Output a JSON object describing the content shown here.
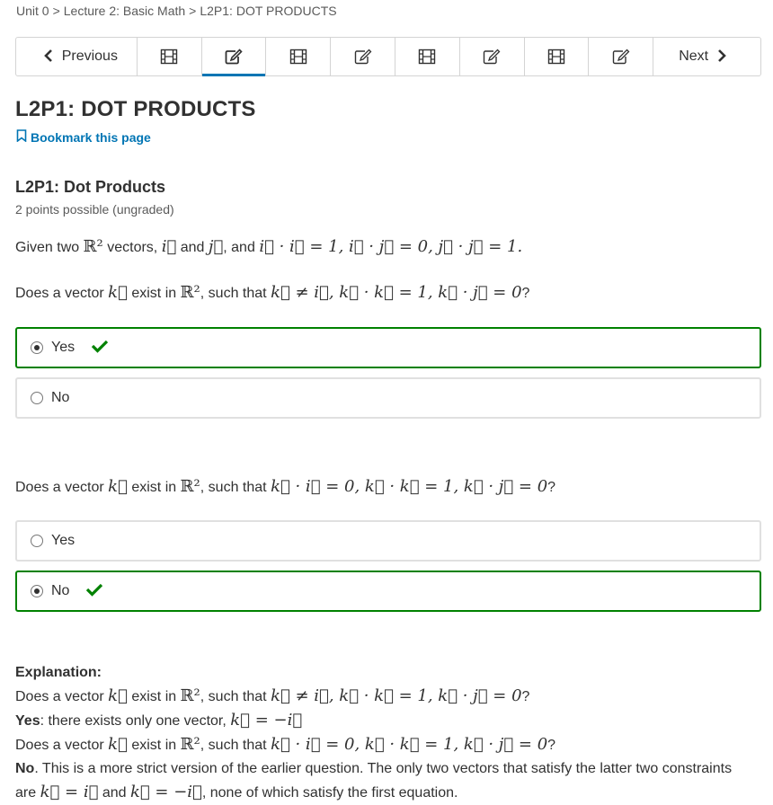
{
  "breadcrumb": {
    "items": [
      "Unit 0",
      "Lecture 2: Basic Math",
      "L2P1: DOT PRODUCTS"
    ],
    "separator": ">"
  },
  "seq_nav": {
    "previous_label": "Previous",
    "next_label": "Next",
    "items": [
      {
        "icon": "video-icon",
        "active": false
      },
      {
        "icon": "problem-edit-icon",
        "active": true
      },
      {
        "icon": "video-icon",
        "active": false
      },
      {
        "icon": "problem-edit-icon",
        "active": false
      },
      {
        "icon": "video-icon",
        "active": false
      },
      {
        "icon": "problem-edit-icon",
        "active": false
      },
      {
        "icon": "video-icon",
        "active": false
      },
      {
        "icon": "problem-edit-icon",
        "active": false
      }
    ],
    "active_color": "#0075b4"
  },
  "unit_title": "L2P1: DOT PRODUCTS",
  "bookmark_label": "Bookmark this page",
  "problem": {
    "title": "L2P1: Dot Products",
    "points": "2 points possible (ungraded)",
    "intro": {
      "prefix": "Given two",
      "r2": "ℝ²",
      "vectors_word": "vectors,",
      "i": "i⃗",
      "and": "and",
      "j": "j⃗",
      "and2": ", and",
      "eq": "i⃗ · i⃗ = 1, i⃗ · j⃗ = 0, j⃗ · j⃗ = 1."
    },
    "q1": {
      "prefix": "Does a vector",
      "k": "k⃗",
      "exist": "exist in",
      "r2": "ℝ²",
      "such": ", such that",
      "cond": "k⃗ ≠ i⃗, k⃗ · k⃗ = 1, k⃗ · j⃗ = 0",
      "q": "?"
    },
    "q1_choices": [
      {
        "label": "Yes",
        "selected": true,
        "correct": true
      },
      {
        "label": "No",
        "selected": false,
        "correct": false
      }
    ],
    "q2": {
      "prefix": "Does a vector",
      "k": "k⃗",
      "exist": "exist in",
      "r2": "ℝ²",
      "such": ", such that",
      "cond": "k⃗ · i⃗ = 0, k⃗ · k⃗ = 1, k⃗ · j⃗ = 0",
      "q": "?"
    },
    "q2_choices": [
      {
        "label": "Yes",
        "selected": false,
        "correct": false
      },
      {
        "label": "No",
        "selected": true,
        "correct": true
      }
    ],
    "correct_color": "#008100"
  },
  "explanation": {
    "heading": "Explanation:",
    "line1": {
      "prefix": "Does a vector",
      "k": "k⃗",
      "exist": "exist in",
      "r2": "ℝ²",
      "such": ", such that",
      "cond": "k⃗ ≠ i⃗, k⃗ · k⃗ = 1, k⃗ · j⃗ = 0",
      "q": "?"
    },
    "line2": {
      "bold": "Yes",
      "text": ": there exists only one vector,",
      "math": "k⃗ = −i⃗"
    },
    "line3": {
      "prefix": "Does a vector",
      "k": "k⃗",
      "exist": "exist in",
      "r2": "ℝ²",
      "such": ", such that",
      "cond": "k⃗ · i⃗ = 0, k⃗ · k⃗ = 1, k⃗ · j⃗ = 0",
      "q": "?"
    },
    "line4": {
      "bold": "No",
      "text": ". This is a more strict version of the earlier question. The only two vectors that satisfy the latter two constraints are",
      "m1": "k⃗ = i⃗",
      "and": "and",
      "m2": "k⃗ = −i⃗",
      "tail": ", none of which satisfy the first equation."
    }
  }
}
